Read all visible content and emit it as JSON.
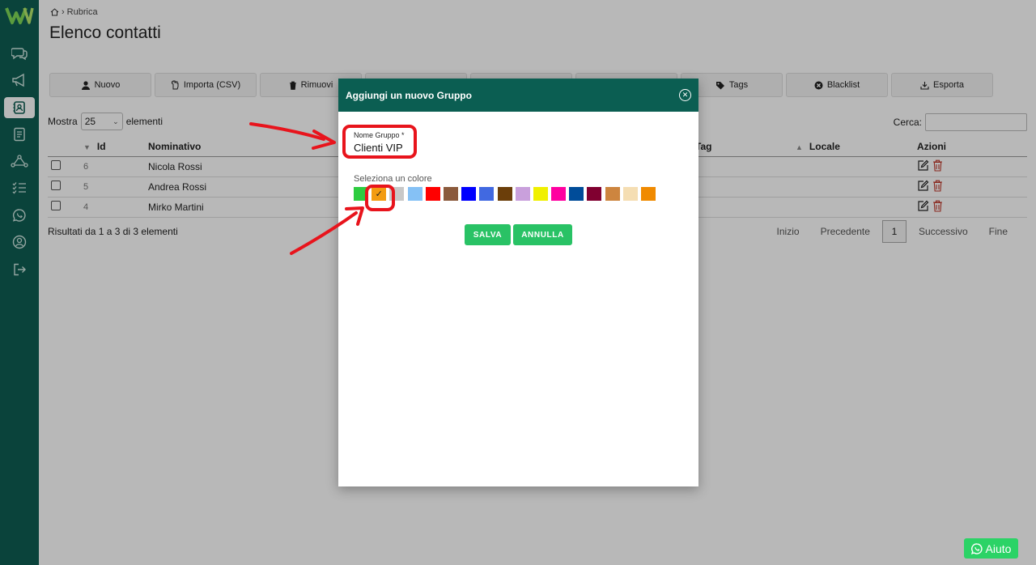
{
  "breadcrumb": {
    "home_icon": "home-icon",
    "current": "Rubrica"
  },
  "page": {
    "title": "Elenco contatti"
  },
  "toolbar": {
    "buttons": [
      {
        "label": "Nuovo",
        "icon": "user-icon"
      },
      {
        "label": "Importa (CSV)",
        "icon": "hand-icon"
      },
      {
        "label": "Rimuovi",
        "icon": "trash-icon"
      },
      {
        "label": "",
        "icon": ""
      },
      {
        "label": "",
        "icon": ""
      },
      {
        "label": "",
        "icon": ""
      },
      {
        "label": "Tags",
        "icon": "tag-icon"
      },
      {
        "label": "Blacklist",
        "icon": "block-icon"
      },
      {
        "label": "Esporta",
        "icon": "export-icon"
      }
    ]
  },
  "list_controls": {
    "show_prefix": "Mostra",
    "show_value": "25",
    "show_suffix": "elementi",
    "search_label": "Cerca:"
  },
  "table": {
    "columns": [
      "Id",
      "Nominativo",
      "Tag",
      "Locale",
      "Azioni"
    ],
    "rows": [
      {
        "id": "6",
        "name": "Nicola Rossi"
      },
      {
        "id": "5",
        "name": "Andrea Rossi"
      },
      {
        "id": "4",
        "name": "Mirko Martini"
      }
    ]
  },
  "results_info": "Risultati da 1 a 3 di 3 elementi",
  "pagination": {
    "first": "Inizio",
    "prev": "Precedente",
    "current": "1",
    "next": "Successivo",
    "last": "Fine"
  },
  "modal": {
    "title": "Aggiungi un nuovo Gruppo",
    "name_label": "Nome Gruppo *",
    "name_value": "Clienti VIP",
    "color_label": "Seleziona un colore",
    "selected_color_index": 1,
    "check_mark": "✓",
    "colors": [
      "#2ecc40",
      "#f39c12",
      "#c8c8c8",
      "#85c1f5",
      "#ff0000",
      "#8b5a3c",
      "#0000ff",
      "#4169e1",
      "#6b3e0a",
      "#c9a0dc",
      "#f0f000",
      "#ff00a0",
      "#004c99",
      "#800030",
      "#cd853f",
      "#f5deb3",
      "#f08a00"
    ],
    "save_label": "SALVA",
    "cancel_label": "ANNULLA",
    "close_icon": "close-icon"
  },
  "help_button": {
    "label": "Aiuto",
    "icon": "whatsapp-icon"
  },
  "theme": {
    "sidebar": "#0f5e52",
    "modal_header": "#0b5e52",
    "accent_green": "#29c265",
    "annotation_red": "#e8141c"
  }
}
